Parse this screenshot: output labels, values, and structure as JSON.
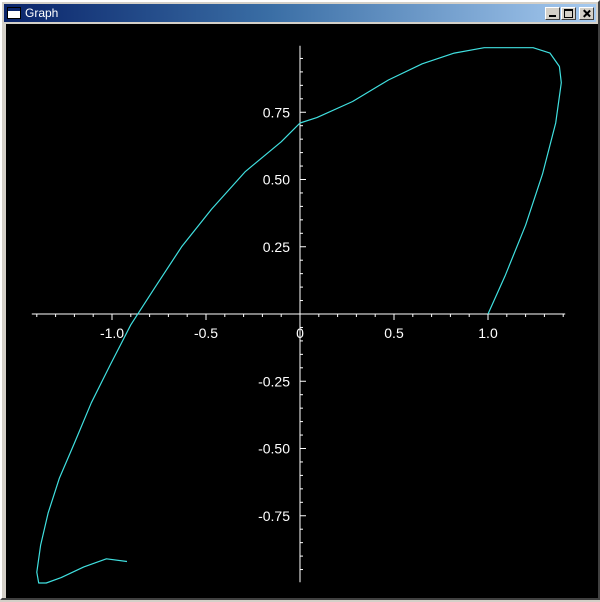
{
  "window": {
    "title": "Graph",
    "icon": "window-icon",
    "controls": [
      "minimize",
      "maximize",
      "close"
    ]
  },
  "colors": {
    "background": "#000000",
    "axes": "#ffffff",
    "curve": "#40e0e0"
  },
  "chart_data": {
    "type": "line",
    "title": "",
    "xlabel": "",
    "ylabel": "",
    "xlim": [
      -1.4,
      1.4
    ],
    "ylim": [
      -0.99,
      0.99
    ],
    "grid": false,
    "legend": "none",
    "x_ticks": [
      {
        "value": -1.0,
        "label": "-1.0"
      },
      {
        "value": -0.5,
        "label": "-0.5"
      },
      {
        "value": 0,
        "label": "0"
      },
      {
        "value": 0.5,
        "label": "0.5"
      },
      {
        "value": 1.0,
        "label": "1.0"
      }
    ],
    "y_ticks": [
      {
        "value": 0.75,
        "label": "0.75"
      },
      {
        "value": 0.5,
        "label": "0.50"
      },
      {
        "value": 0.25,
        "label": "0.25"
      },
      {
        "value": -0.25,
        "label": "-0.25"
      },
      {
        "value": -0.5,
        "label": "-0.50"
      },
      {
        "value": -0.75,
        "label": "-0.75"
      }
    ],
    "series": [
      {
        "x": [
          1.0,
          1.09,
          1.2,
          1.29,
          1.36,
          1.39,
          1.38,
          1.33,
          1.24,
          1.12,
          0.98,
          0.82,
          0.65,
          0.47,
          0.28,
          0.09,
          0.0,
          -0.1,
          -0.29,
          -0.47,
          -0.63,
          -0.77,
          -0.9,
          -1.01,
          -1.11,
          -1.2,
          -1.28,
          -1.34,
          -1.38,
          -1.4,
          -1.39,
          -1.35,
          -1.27,
          -1.15,
          -1.03,
          -0.92
        ],
        "y": [
          0.0,
          0.14,
          0.33,
          0.52,
          0.71,
          0.86,
          0.92,
          0.97,
          0.99,
          0.99,
          0.99,
          0.97,
          0.93,
          0.87,
          0.79,
          0.73,
          0.71,
          0.64,
          0.53,
          0.39,
          0.25,
          0.1,
          -0.04,
          -0.19,
          -0.33,
          -0.48,
          -0.61,
          -0.74,
          -0.86,
          -0.96,
          -1.0,
          -1.0,
          -0.98,
          -0.94,
          -0.91,
          -0.92
        ]
      }
    ]
  }
}
